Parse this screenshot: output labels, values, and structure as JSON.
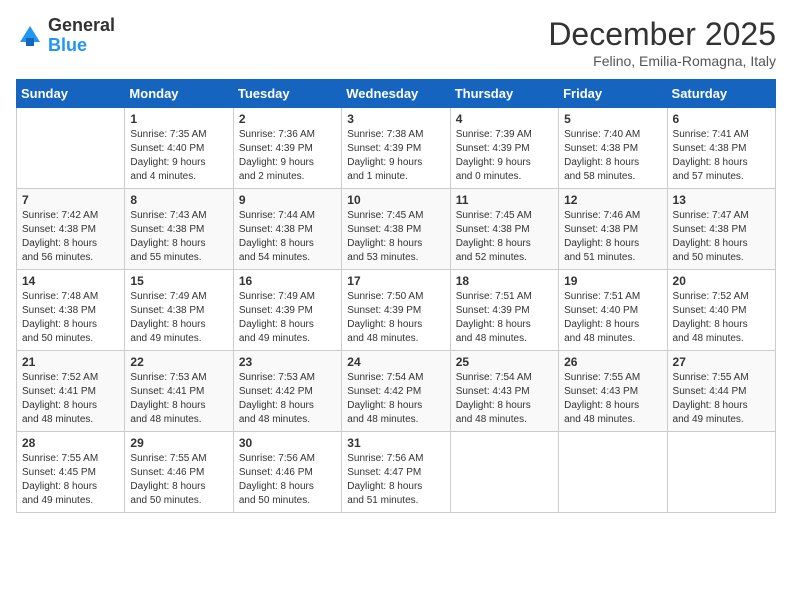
{
  "logo": {
    "general": "General",
    "blue": "Blue"
  },
  "title": "December 2025",
  "location": "Felino, Emilia-Romagna, Italy",
  "weekdays": [
    "Sunday",
    "Monday",
    "Tuesday",
    "Wednesday",
    "Thursday",
    "Friday",
    "Saturday"
  ],
  "weeks": [
    [
      {
        "day": "",
        "info": ""
      },
      {
        "day": "1",
        "info": "Sunrise: 7:35 AM\nSunset: 4:40 PM\nDaylight: 9 hours\nand 4 minutes."
      },
      {
        "day": "2",
        "info": "Sunrise: 7:36 AM\nSunset: 4:39 PM\nDaylight: 9 hours\nand 2 minutes."
      },
      {
        "day": "3",
        "info": "Sunrise: 7:38 AM\nSunset: 4:39 PM\nDaylight: 9 hours\nand 1 minute."
      },
      {
        "day": "4",
        "info": "Sunrise: 7:39 AM\nSunset: 4:39 PM\nDaylight: 9 hours\nand 0 minutes."
      },
      {
        "day": "5",
        "info": "Sunrise: 7:40 AM\nSunset: 4:38 PM\nDaylight: 8 hours\nand 58 minutes."
      },
      {
        "day": "6",
        "info": "Sunrise: 7:41 AM\nSunset: 4:38 PM\nDaylight: 8 hours\nand 57 minutes."
      }
    ],
    [
      {
        "day": "7",
        "info": "Sunrise: 7:42 AM\nSunset: 4:38 PM\nDaylight: 8 hours\nand 56 minutes."
      },
      {
        "day": "8",
        "info": "Sunrise: 7:43 AM\nSunset: 4:38 PM\nDaylight: 8 hours\nand 55 minutes."
      },
      {
        "day": "9",
        "info": "Sunrise: 7:44 AM\nSunset: 4:38 PM\nDaylight: 8 hours\nand 54 minutes."
      },
      {
        "day": "10",
        "info": "Sunrise: 7:45 AM\nSunset: 4:38 PM\nDaylight: 8 hours\nand 53 minutes."
      },
      {
        "day": "11",
        "info": "Sunrise: 7:45 AM\nSunset: 4:38 PM\nDaylight: 8 hours\nand 52 minutes."
      },
      {
        "day": "12",
        "info": "Sunrise: 7:46 AM\nSunset: 4:38 PM\nDaylight: 8 hours\nand 51 minutes."
      },
      {
        "day": "13",
        "info": "Sunrise: 7:47 AM\nSunset: 4:38 PM\nDaylight: 8 hours\nand 50 minutes."
      }
    ],
    [
      {
        "day": "14",
        "info": "Sunrise: 7:48 AM\nSunset: 4:38 PM\nDaylight: 8 hours\nand 50 minutes."
      },
      {
        "day": "15",
        "info": "Sunrise: 7:49 AM\nSunset: 4:38 PM\nDaylight: 8 hours\nand 49 minutes."
      },
      {
        "day": "16",
        "info": "Sunrise: 7:49 AM\nSunset: 4:39 PM\nDaylight: 8 hours\nand 49 minutes."
      },
      {
        "day": "17",
        "info": "Sunrise: 7:50 AM\nSunset: 4:39 PM\nDaylight: 8 hours\nand 48 minutes."
      },
      {
        "day": "18",
        "info": "Sunrise: 7:51 AM\nSunset: 4:39 PM\nDaylight: 8 hours\nand 48 minutes."
      },
      {
        "day": "19",
        "info": "Sunrise: 7:51 AM\nSunset: 4:40 PM\nDaylight: 8 hours\nand 48 minutes."
      },
      {
        "day": "20",
        "info": "Sunrise: 7:52 AM\nSunset: 4:40 PM\nDaylight: 8 hours\nand 48 minutes."
      }
    ],
    [
      {
        "day": "21",
        "info": "Sunrise: 7:52 AM\nSunset: 4:41 PM\nDaylight: 8 hours\nand 48 minutes."
      },
      {
        "day": "22",
        "info": "Sunrise: 7:53 AM\nSunset: 4:41 PM\nDaylight: 8 hours\nand 48 minutes."
      },
      {
        "day": "23",
        "info": "Sunrise: 7:53 AM\nSunset: 4:42 PM\nDaylight: 8 hours\nand 48 minutes."
      },
      {
        "day": "24",
        "info": "Sunrise: 7:54 AM\nSunset: 4:42 PM\nDaylight: 8 hours\nand 48 minutes."
      },
      {
        "day": "25",
        "info": "Sunrise: 7:54 AM\nSunset: 4:43 PM\nDaylight: 8 hours\nand 48 minutes."
      },
      {
        "day": "26",
        "info": "Sunrise: 7:55 AM\nSunset: 4:43 PM\nDaylight: 8 hours\nand 48 minutes."
      },
      {
        "day": "27",
        "info": "Sunrise: 7:55 AM\nSunset: 4:44 PM\nDaylight: 8 hours\nand 49 minutes."
      }
    ],
    [
      {
        "day": "28",
        "info": "Sunrise: 7:55 AM\nSunset: 4:45 PM\nDaylight: 8 hours\nand 49 minutes."
      },
      {
        "day": "29",
        "info": "Sunrise: 7:55 AM\nSunset: 4:46 PM\nDaylight: 8 hours\nand 50 minutes."
      },
      {
        "day": "30",
        "info": "Sunrise: 7:56 AM\nSunset: 4:46 PM\nDaylight: 8 hours\nand 50 minutes."
      },
      {
        "day": "31",
        "info": "Sunrise: 7:56 AM\nSunset: 4:47 PM\nDaylight: 8 hours\nand 51 minutes."
      },
      {
        "day": "",
        "info": ""
      },
      {
        "day": "",
        "info": ""
      },
      {
        "day": "",
        "info": ""
      }
    ]
  ]
}
